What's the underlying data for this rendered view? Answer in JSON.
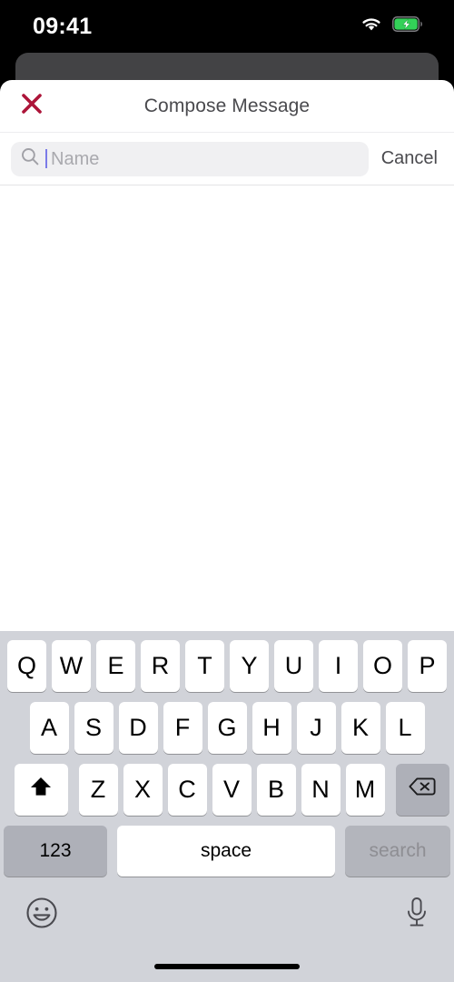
{
  "status_bar": {
    "time": "09:41",
    "wifi_icon": "wifi-icon",
    "battery_icon": "battery-charging-icon",
    "battery_color": "#33D158"
  },
  "background_card": {
    "name": "stacked-modal-card-behind",
    "color": "#434345"
  },
  "sheet": {
    "title": "Compose Message",
    "close_icon": "close-x-icon",
    "close_icon_color": "#AD1539",
    "title_color": "#4A4A4E"
  },
  "search": {
    "icon": "search-magnifier-icon",
    "placeholder": "Name",
    "value": "",
    "caret_color": "#7B7BE8",
    "cancel_label": "Cancel"
  },
  "results": {
    "items": []
  },
  "keyboard": {
    "background_color": "#D1D3D9",
    "row1": [
      "Q",
      "W",
      "E",
      "R",
      "T",
      "Y",
      "U",
      "I",
      "O",
      "P"
    ],
    "row2": [
      "A",
      "S",
      "D",
      "F",
      "G",
      "H",
      "J",
      "K",
      "L"
    ],
    "row3": [
      "Z",
      "X",
      "C",
      "V",
      "B",
      "N",
      "M"
    ],
    "shift_icon": "shift-up-arrow-icon",
    "backspace_icon": "backspace-delete-icon",
    "numbers_label": "123",
    "space_label": "space",
    "return_label": "search",
    "emoji_icon": "emoji-smiley-icon",
    "dictation_icon": "microphone-icon"
  },
  "home_indicator": {
    "name": "home-indicator-bar"
  }
}
